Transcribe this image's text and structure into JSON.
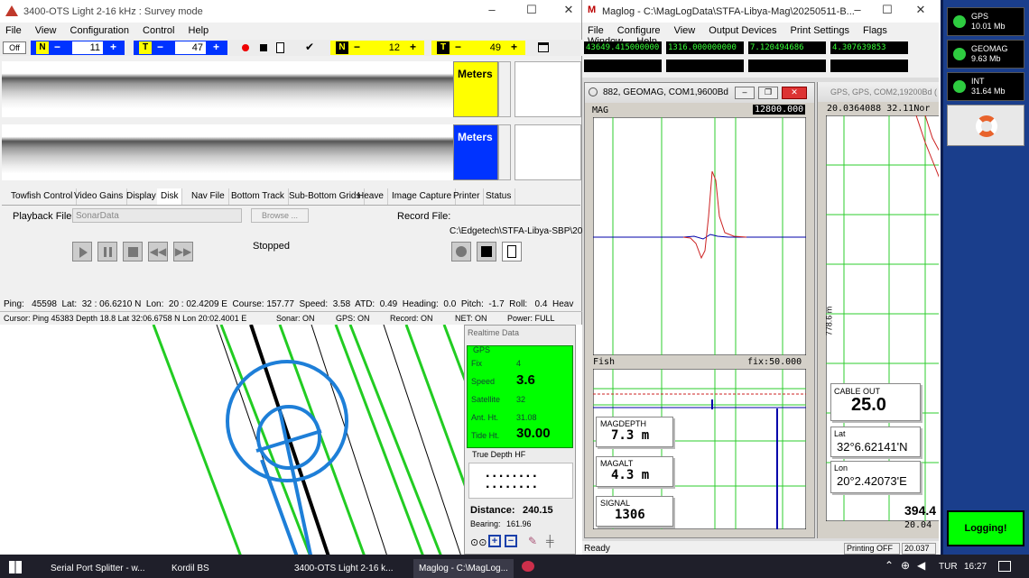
{
  "sonar": {
    "title": "3400-OTS Light 2-16 kHz : Survey mode",
    "menu": [
      "File",
      "View",
      "Configuration",
      "Control",
      "Help"
    ],
    "off_label": "Off",
    "toolbar": {
      "n1_value": "11",
      "t1_value": "47",
      "n2_value": "12",
      "t2_value": "49",
      "n_label": "N",
      "t_label": "T",
      "minus": "−",
      "plus": "+"
    },
    "meters_top": "Meters",
    "meters_bottom": "Meters",
    "tabs": [
      "Towfish Control",
      "Video Gains",
      "Display",
      "Disk",
      "Nav File",
      "Bottom Track",
      "Sub-Bottom Grids",
      "Heave",
      "Image Capture",
      "Printer",
      "Status"
    ],
    "playback_label": "Playback File:",
    "playback_value": "SonarData",
    "browse_label": "Browse ...",
    "record_label": "Record File:",
    "record_path": "C:\\Edgetech\\STFA-Libya-SBP\\2025",
    "stopped": "Stopped",
    "status1": "Ping:   45598  Lat:  32 : 06.6210 N  Lon:  20 : 02.4209 E  Course: 157.77  Speed:  3.58  ATD:  0.49  Heading:  0.0  Pitch:  -1.7  Roll:   0.4  Heav",
    "status2": {
      "cursor": "Cursor: Ping 45383  Depth 18.8  Lat 32:06.6758 N  Lon 20:02.4001 E",
      "sonar": "Sonar: ON",
      "gps": "GPS: ON",
      "record": "Record: ON",
      "net": "NET: ON",
      "power": "Power: FULL"
    }
  },
  "realtime": {
    "title": "Realtime Data",
    "gps_group": "GPS",
    "fix_label": "Fix",
    "fix_value": "4",
    "speed_label": "Speed",
    "speed_value": "3.6",
    "satellite_label": "Satellite",
    "satellite_value": "32",
    "ant_label": "Ant. Ht.",
    "ant_value": "31.08",
    "tide_label": "Tide Ht.",
    "tide_value": "30.00",
    "true_depth": "True Depth HF",
    "depth_dots": "........",
    "distance_label": "Distance:",
    "distance_value": "240.15",
    "bearing_label": "Bearing:",
    "bearing_value": "161.96"
  },
  "maglog": {
    "title": "Maglog - C:\\MagLogData\\STFA-Libya-Mag\\20250511-B...",
    "menu": [
      "File",
      "Configure",
      "View",
      "Output Devices",
      "Print Settings",
      "Flags",
      "Window",
      "Help"
    ],
    "readouts": [
      "43649.415000000",
      "1316.000000000",
      "7.120494686",
      "4.307639853"
    ],
    "status_ready": "Ready",
    "printing": "Printing OFF",
    "status_tail": "20.037"
  },
  "geomag": {
    "title": "882, GEOMAG, COM1,9600Bd",
    "mag_label": "MAG",
    "mag_value": "12800.000",
    "fish_label": "Fish",
    "fix_label": "fix:50.000",
    "magdepth_label": "MAGDEPTH",
    "magdepth_value": "7.3 m",
    "magalt_label": "MAGALT",
    "magalt_value": "4.3 m",
    "signal_label": "SIGNAL",
    "signal_value": "1306"
  },
  "gpswin": {
    "title": "GPS, GPS, COM2,19200Bd (",
    "coord_text": "20.0364088 32.11Nor",
    "axis_label": "778.6 m",
    "cable_label": "CABLE OUT",
    "cable_value": "25.0",
    "lat_label": "Lat",
    "lat_value": "32°6.62141'N",
    "lon_label": "Lon",
    "lon_value": "20°2.42073'E",
    "big_value": "394.4",
    "bottom_value": "20.04"
  },
  "sidebar": {
    "gps_label": "GPS",
    "gps_size": "10.01 Mb",
    "geomag_label": "GEOMAG",
    "geomag_size": "9.63 Mb",
    "int_label": "INT",
    "int_size": "31.64 Mb",
    "logging": "Logging!"
  },
  "taskbar": {
    "items": [
      "Serial Port Splitter - w...",
      "Kordil BS",
      "3400-OTS Light 2-16 k...",
      "Maglog - C:\\MagLog..."
    ],
    "lang": "TUR",
    "time": "16:27"
  },
  "colors": {
    "green": "#00ff00",
    "yellow": "#ffff00",
    "blue": "#0033ff",
    "accent": "#0078d7",
    "taskbar": "#1f1f2a"
  }
}
